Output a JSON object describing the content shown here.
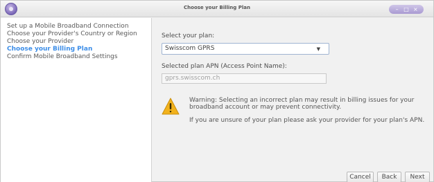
{
  "window": {
    "title": "Choose your Billing Plan",
    "app_icon": "modem-manager-icon",
    "controls": {
      "minimize": "–",
      "maximize": "□",
      "close": "×"
    }
  },
  "sidebar": {
    "steps": [
      {
        "label": "Set up a Mobile Broadband Connection",
        "active": false
      },
      {
        "label": "Choose your Provider's Country or Region",
        "active": false
      },
      {
        "label": "Choose your Provider",
        "active": false
      },
      {
        "label": "Choose your Billing Plan",
        "active": true
      },
      {
        "label": "Confirm Mobile Broadband Settings",
        "active": false
      }
    ]
  },
  "form": {
    "plan_label": "Select your plan:",
    "plan_selected": "Swisscom GPRS",
    "apn_label": "Selected plan APN (Access Point Name):",
    "apn_value": "gprs.swisscom.ch"
  },
  "warning": {
    "icon": "warning-icon",
    "line1": "Warning: Selecting an incorrect plan may result in billing issues for your",
    "line2": "broadband account or may prevent connectivity.",
    "line3": "If you are unsure of your plan please ask your provider for your plan's APN."
  },
  "buttons": {
    "cancel": "Cancel",
    "back": "Back",
    "next": "Next"
  },
  "colors": {
    "accent": "#3d8ee8",
    "warning": "#f2b21c",
    "titlebar_buttons": "#b3a5d9"
  }
}
